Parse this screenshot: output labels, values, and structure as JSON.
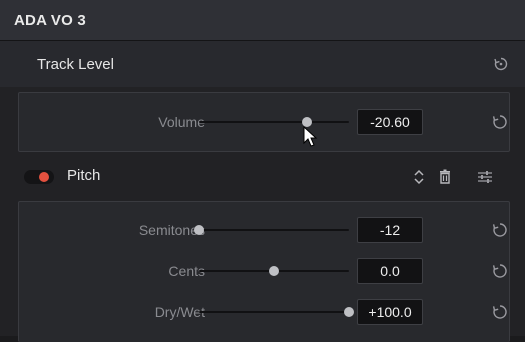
{
  "header": {
    "title": "ADA VO 3"
  },
  "track_level": {
    "label": "Track Level"
  },
  "volume": {
    "label": "Volume",
    "value": "-20.60",
    "slider_fraction": 0.72
  },
  "pitch": {
    "label": "Pitch",
    "enabled": true,
    "params": [
      {
        "label": "Semitones",
        "value": "-12",
        "slider_fraction": 0.0
      },
      {
        "label": "Cents",
        "value": "0.0",
        "slider_fraction": 0.5
      },
      {
        "label": "Dry/Wet",
        "value": "+100.0",
        "slider_fraction": 1.0
      }
    ]
  },
  "colors": {
    "toggle_on": "#e3513f",
    "panel_bg": "#222225",
    "header_bg": "#2f3036"
  },
  "icons": [
    "reset-icon",
    "up-down-chevron-icon",
    "trash-icon",
    "sliders-icon",
    "mouse-cursor-icon"
  ]
}
